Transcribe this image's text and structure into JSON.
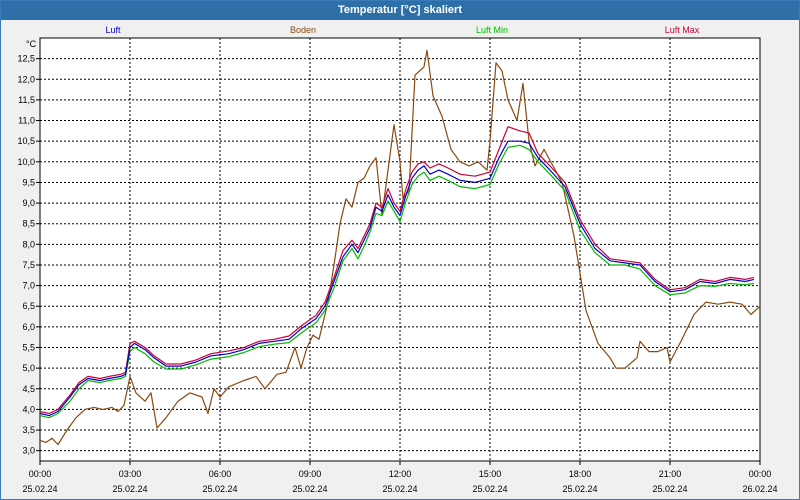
{
  "window": {
    "title": "Temperatur [°C] skaliert"
  },
  "chart_data": {
    "type": "line",
    "title": "Temperatur [°C] skaliert",
    "ylabel": "°C",
    "ylim": [
      2.75,
      13.0
    ],
    "yticks": [
      3.0,
      3.5,
      4.0,
      4.5,
      5.0,
      5.5,
      6.0,
      6.5,
      7.0,
      7.5,
      8.0,
      8.5,
      9.0,
      9.5,
      10.0,
      10.5,
      11.0,
      11.5,
      12.0,
      12.5
    ],
    "ytick_labels": [
      "3,0",
      "3,5",
      "4,0",
      "4,5",
      "5,0",
      "5,5",
      "6,0",
      "6,5",
      "7,0",
      "7,5",
      "8,0",
      "8,5",
      "9,0",
      "9,5",
      "10,0",
      "10,5",
      "11,0",
      "11,5",
      "12,0",
      "12,5"
    ],
    "xlim": [
      0,
      24
    ],
    "xticks": [
      0,
      3,
      6,
      9,
      12,
      15,
      18,
      21,
      24
    ],
    "xtick_labels": [
      {
        "time": "00:00",
        "date": "25.02.24"
      },
      {
        "time": "03:00",
        "date": "25.02.24"
      },
      {
        "time": "06:00",
        "date": "25.02.24"
      },
      {
        "time": "09:00",
        "date": "25.02.24"
      },
      {
        "time": "12:00",
        "date": "25.02.24"
      },
      {
        "time": "15:00",
        "date": "25.02.24"
      },
      {
        "time": "18:00",
        "date": "25.02.24"
      },
      {
        "time": "21:00",
        "date": "25.02.24"
      },
      {
        "time": "00:00",
        "date": "26.02.24"
      }
    ],
    "grid": true,
    "legend": "top",
    "series": [
      {
        "name": "Luft",
        "color": "#0000cc",
        "points": [
          [
            0,
            3.9
          ],
          [
            0.3,
            3.85
          ],
          [
            0.6,
            3.95
          ],
          [
            1,
            4.3
          ],
          [
            1.3,
            4.6
          ],
          [
            1.6,
            4.75
          ],
          [
            2,
            4.7
          ],
          [
            2.3,
            4.75
          ],
          [
            2.7,
            4.8
          ],
          [
            2.85,
            4.85
          ],
          [
            3,
            5.5
          ],
          [
            3.15,
            5.6
          ],
          [
            3.5,
            5.45
          ],
          [
            3.8,
            5.25
          ],
          [
            4.2,
            5.05
          ],
          [
            4.7,
            5.05
          ],
          [
            5.2,
            5.15
          ],
          [
            5.7,
            5.3
          ],
          [
            6.3,
            5.35
          ],
          [
            6.8,
            5.45
          ],
          [
            7.3,
            5.6
          ],
          [
            7.8,
            5.65
          ],
          [
            8.3,
            5.7
          ],
          [
            8.7,
            5.95
          ],
          [
            9.2,
            6.2
          ],
          [
            9.5,
            6.5
          ],
          [
            9.8,
            7.1
          ],
          [
            10.1,
            7.7
          ],
          [
            10.4,
            8.0
          ],
          [
            10.6,
            7.8
          ],
          [
            10.8,
            8.1
          ],
          [
            11.0,
            8.4
          ],
          [
            11.2,
            8.9
          ],
          [
            11.4,
            8.8
          ],
          [
            11.6,
            9.2
          ],
          [
            11.8,
            8.9
          ],
          [
            12.0,
            8.7
          ],
          [
            12.2,
            9.2
          ],
          [
            12.4,
            9.6
          ],
          [
            12.6,
            9.8
          ],
          [
            12.8,
            9.9
          ],
          [
            13.0,
            9.7
          ],
          [
            13.3,
            9.8
          ],
          [
            13.6,
            9.7
          ],
          [
            14.0,
            9.55
          ],
          [
            14.5,
            9.5
          ],
          [
            15.0,
            9.6
          ],
          [
            15.3,
            10.1
          ],
          [
            15.6,
            10.5
          ],
          [
            16.0,
            10.5
          ],
          [
            16.3,
            10.45
          ],
          [
            16.6,
            10.1
          ],
          [
            17.0,
            9.8
          ],
          [
            17.5,
            9.4
          ],
          [
            18.0,
            8.5
          ],
          [
            18.5,
            7.9
          ],
          [
            19.0,
            7.6
          ],
          [
            19.5,
            7.55
          ],
          [
            20.0,
            7.5
          ],
          [
            20.5,
            7.1
          ],
          [
            21.0,
            6.85
          ],
          [
            21.5,
            6.9
          ],
          [
            22.0,
            7.1
          ],
          [
            22.5,
            7.05
          ],
          [
            23.0,
            7.15
          ],
          [
            23.5,
            7.1
          ],
          [
            23.8,
            7.15
          ]
        ]
      },
      {
        "name": "Boden",
        "color": "#8b4a10",
        "points": [
          [
            0,
            3.25
          ],
          [
            0.2,
            3.2
          ],
          [
            0.4,
            3.3
          ],
          [
            0.6,
            3.15
          ],
          [
            0.9,
            3.5
          ],
          [
            1.2,
            3.8
          ],
          [
            1.5,
            4.0
          ],
          [
            1.8,
            4.05
          ],
          [
            2.1,
            4.0
          ],
          [
            2.4,
            4.05
          ],
          [
            2.6,
            3.95
          ],
          [
            2.8,
            4.1
          ],
          [
            3.0,
            4.8
          ],
          [
            3.2,
            4.4
          ],
          [
            3.5,
            4.2
          ],
          [
            3.7,
            4.4
          ],
          [
            3.9,
            3.55
          ],
          [
            4.2,
            3.8
          ],
          [
            4.6,
            4.2
          ],
          [
            5.0,
            4.4
          ],
          [
            5.4,
            4.3
          ],
          [
            5.6,
            3.9
          ],
          [
            5.8,
            4.5
          ],
          [
            6.0,
            4.3
          ],
          [
            6.3,
            4.55
          ],
          [
            6.8,
            4.7
          ],
          [
            7.2,
            4.8
          ],
          [
            7.5,
            4.5
          ],
          [
            7.9,
            4.85
          ],
          [
            8.2,
            4.9
          ],
          [
            8.5,
            5.5
          ],
          [
            8.7,
            5.0
          ],
          [
            8.9,
            5.5
          ],
          [
            9.1,
            5.8
          ],
          [
            9.3,
            5.7
          ],
          [
            9.6,
            6.6
          ],
          [
            9.8,
            7.5
          ],
          [
            10.0,
            8.5
          ],
          [
            10.2,
            9.1
          ],
          [
            10.4,
            8.9
          ],
          [
            10.6,
            9.5
          ],
          [
            10.8,
            9.6
          ],
          [
            11.0,
            9.9
          ],
          [
            11.2,
            10.1
          ],
          [
            11.4,
            8.7
          ],
          [
            11.6,
            9.8
          ],
          [
            11.8,
            10.9
          ],
          [
            12.0,
            10.0
          ],
          [
            12.1,
            9.1
          ],
          [
            12.3,
            9.3
          ],
          [
            12.5,
            12.1
          ],
          [
            12.8,
            12.3
          ],
          [
            12.9,
            12.7
          ],
          [
            13.1,
            11.6
          ],
          [
            13.4,
            11.1
          ],
          [
            13.7,
            10.3
          ],
          [
            14.0,
            10.0
          ],
          [
            14.3,
            9.9
          ],
          [
            14.6,
            10.0
          ],
          [
            14.9,
            9.8
          ],
          [
            15.0,
            10.5
          ],
          [
            15.2,
            12.4
          ],
          [
            15.4,
            12.2
          ],
          [
            15.6,
            11.5
          ],
          [
            15.9,
            11.0
          ],
          [
            16.1,
            11.9
          ],
          [
            16.3,
            10.5
          ],
          [
            16.5,
            9.9
          ],
          [
            16.8,
            10.3
          ],
          [
            17.1,
            9.9
          ],
          [
            17.4,
            9.5
          ],
          [
            17.8,
            8.2
          ],
          [
            18.2,
            6.4
          ],
          [
            18.6,
            5.6
          ],
          [
            19.0,
            5.25
          ],
          [
            19.2,
            5.0
          ],
          [
            19.5,
            5.0
          ],
          [
            19.9,
            5.25
          ],
          [
            20.0,
            5.65
          ],
          [
            20.3,
            5.4
          ],
          [
            20.6,
            5.4
          ],
          [
            20.9,
            5.5
          ],
          [
            21.0,
            5.15
          ],
          [
            21.4,
            5.7
          ],
          [
            21.8,
            6.3
          ],
          [
            22.2,
            6.6
          ],
          [
            22.6,
            6.55
          ],
          [
            23.0,
            6.6
          ],
          [
            23.4,
            6.55
          ],
          [
            23.7,
            6.3
          ],
          [
            24.0,
            6.5
          ]
        ]
      },
      {
        "name": "Luft Min",
        "color": "#00bb00",
        "points": [
          [
            0,
            3.85
          ],
          [
            0.3,
            3.8
          ],
          [
            0.6,
            3.9
          ],
          [
            1,
            4.2
          ],
          [
            1.3,
            4.5
          ],
          [
            1.6,
            4.7
          ],
          [
            2,
            4.65
          ],
          [
            2.3,
            4.7
          ],
          [
            2.7,
            4.75
          ],
          [
            2.85,
            4.8
          ],
          [
            3,
            5.4
          ],
          [
            3.15,
            5.5
          ],
          [
            3.5,
            5.35
          ],
          [
            3.8,
            5.15
          ],
          [
            4.2,
            4.98
          ],
          [
            4.7,
            4.98
          ],
          [
            5.2,
            5.08
          ],
          [
            5.7,
            5.22
          ],
          [
            6.3,
            5.28
          ],
          [
            6.8,
            5.38
          ],
          [
            7.3,
            5.52
          ],
          [
            7.8,
            5.58
          ],
          [
            8.3,
            5.62
          ],
          [
            8.7,
            5.85
          ],
          [
            9.2,
            6.1
          ],
          [
            9.5,
            6.4
          ],
          [
            9.8,
            6.95
          ],
          [
            10.1,
            7.6
          ],
          [
            10.4,
            7.9
          ],
          [
            10.6,
            7.65
          ],
          [
            10.8,
            7.95
          ],
          [
            11.0,
            8.3
          ],
          [
            11.2,
            8.75
          ],
          [
            11.4,
            8.7
          ],
          [
            11.6,
            9.05
          ],
          [
            11.8,
            8.8
          ],
          [
            12.0,
            8.55
          ],
          [
            12.2,
            9.05
          ],
          [
            12.4,
            9.45
          ],
          [
            12.6,
            9.65
          ],
          [
            12.8,
            9.75
          ],
          [
            13.0,
            9.55
          ],
          [
            13.3,
            9.65
          ],
          [
            13.6,
            9.55
          ],
          [
            14.0,
            9.4
          ],
          [
            14.5,
            9.35
          ],
          [
            15.0,
            9.45
          ],
          [
            15.3,
            9.95
          ],
          [
            15.6,
            10.35
          ],
          [
            16.0,
            10.4
          ],
          [
            16.3,
            10.3
          ],
          [
            16.6,
            10.0
          ],
          [
            17.0,
            9.7
          ],
          [
            17.5,
            9.3
          ],
          [
            18.0,
            8.35
          ],
          [
            18.5,
            7.8
          ],
          [
            19.0,
            7.5
          ],
          [
            19.5,
            7.5
          ],
          [
            20.0,
            7.4
          ],
          [
            20.5,
            7.0
          ],
          [
            21.0,
            6.78
          ],
          [
            21.5,
            6.82
          ],
          [
            22.0,
            7.0
          ],
          [
            22.5,
            6.98
          ],
          [
            23.0,
            7.05
          ],
          [
            23.5,
            7.02
          ],
          [
            23.8,
            7.05
          ]
        ]
      },
      {
        "name": "Luft Max",
        "color": "#cc0033",
        "points": [
          [
            0,
            3.95
          ],
          [
            0.3,
            3.9
          ],
          [
            0.6,
            4.0
          ],
          [
            1,
            4.35
          ],
          [
            1.3,
            4.65
          ],
          [
            1.6,
            4.8
          ],
          [
            2,
            4.75
          ],
          [
            2.3,
            4.8
          ],
          [
            2.7,
            4.85
          ],
          [
            2.85,
            4.9
          ],
          [
            3,
            5.6
          ],
          [
            3.15,
            5.65
          ],
          [
            3.5,
            5.5
          ],
          [
            3.8,
            5.3
          ],
          [
            4.2,
            5.1
          ],
          [
            4.7,
            5.1
          ],
          [
            5.2,
            5.2
          ],
          [
            5.7,
            5.35
          ],
          [
            6.3,
            5.42
          ],
          [
            6.8,
            5.5
          ],
          [
            7.3,
            5.65
          ],
          [
            7.8,
            5.7
          ],
          [
            8.3,
            5.78
          ],
          [
            8.7,
            6.02
          ],
          [
            9.2,
            6.28
          ],
          [
            9.5,
            6.6
          ],
          [
            9.8,
            7.2
          ],
          [
            10.1,
            7.85
          ],
          [
            10.4,
            8.1
          ],
          [
            10.6,
            7.9
          ],
          [
            10.8,
            8.2
          ],
          [
            11.0,
            8.5
          ],
          [
            11.2,
            9.0
          ],
          [
            11.4,
            8.9
          ],
          [
            11.6,
            9.35
          ],
          [
            11.8,
            9.0
          ],
          [
            12.0,
            8.8
          ],
          [
            12.2,
            9.35
          ],
          [
            12.4,
            9.75
          ],
          [
            12.6,
            9.95
          ],
          [
            12.8,
            10.0
          ],
          [
            13.0,
            9.85
          ],
          [
            13.3,
            9.95
          ],
          [
            13.6,
            9.85
          ],
          [
            14.0,
            9.7
          ],
          [
            14.5,
            9.65
          ],
          [
            15.0,
            9.75
          ],
          [
            15.3,
            10.3
          ],
          [
            15.6,
            10.85
          ],
          [
            16.0,
            10.75
          ],
          [
            16.3,
            10.7
          ],
          [
            16.6,
            10.2
          ],
          [
            17.0,
            9.9
          ],
          [
            17.5,
            9.5
          ],
          [
            18.0,
            8.6
          ],
          [
            18.5,
            8.0
          ],
          [
            19.0,
            7.65
          ],
          [
            19.5,
            7.6
          ],
          [
            20.0,
            7.55
          ],
          [
            20.5,
            7.15
          ],
          [
            21.0,
            6.9
          ],
          [
            21.5,
            6.95
          ],
          [
            22.0,
            7.15
          ],
          [
            22.5,
            7.1
          ],
          [
            23.0,
            7.2
          ],
          [
            23.5,
            7.15
          ],
          [
            23.8,
            7.2
          ]
        ]
      }
    ]
  }
}
